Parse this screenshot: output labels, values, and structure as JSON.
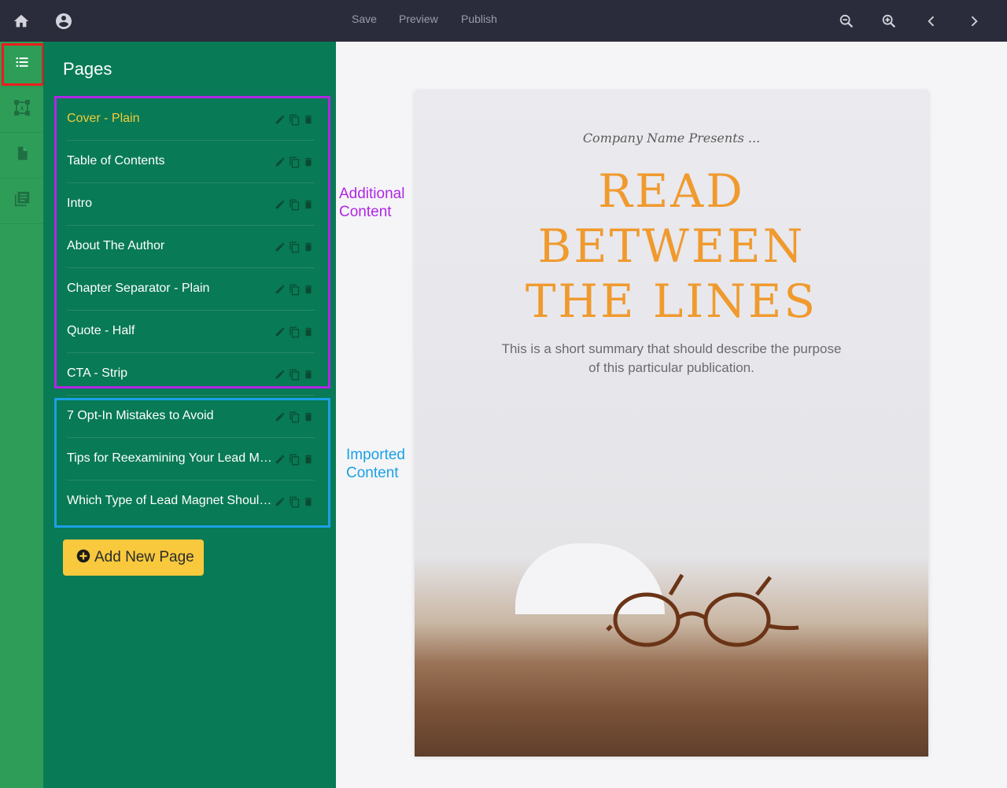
{
  "toolbar": {
    "save_label": "Save",
    "preview_label": "Preview",
    "publish_label": "Publish"
  },
  "panel": {
    "title": "Pages",
    "pages": [
      {
        "label": "Cover - Plain",
        "active": true
      },
      {
        "label": "Table of Contents"
      },
      {
        "label": "Intro"
      },
      {
        "label": "About The Author"
      },
      {
        "label": "Chapter Separator - Plain"
      },
      {
        "label": "Quote - Half"
      },
      {
        "label": "CTA - Strip"
      },
      {
        "label": "7 Opt-In Mistakes to Avoid"
      },
      {
        "label": "Tips for Reexamining Your Lead Magnet"
      },
      {
        "label": "Which Type of Lead Magnet Should You Use"
      }
    ],
    "add_button_label": "Add New Page"
  },
  "annotations": {
    "additional": "Additional\nContent",
    "imported": "Imported\nContent"
  },
  "document": {
    "presents": "Company Name Presents ...",
    "title_line1": "READ",
    "title_line2": "BETWEEN",
    "title_line3": "THE LINES",
    "summary": "This is a short summary that should describe the purpose of this particular publication."
  },
  "colors": {
    "topbar": "#2b2c3b",
    "rail": "#2e9d58",
    "panel": "#087a55",
    "active_page": "#f3cc3a",
    "accent_button": "#f8c93d",
    "title_orange": "#f09a2e",
    "annotation_purple": "#b026e6",
    "annotation_blue": "#1ba0e6",
    "highlight_red": "#ee1c1c"
  },
  "icons": {
    "topbar_left": [
      "home-icon",
      "account-icon"
    ],
    "topbar_right": [
      "zoom-out-icon",
      "zoom-in-icon",
      "chevron-left-icon",
      "chevron-right-icon"
    ],
    "rail": [
      "list-icon",
      "layout-icon",
      "page-icon",
      "library-icon"
    ],
    "row_actions": [
      "edit-icon",
      "copy-icon",
      "delete-icon"
    ]
  }
}
